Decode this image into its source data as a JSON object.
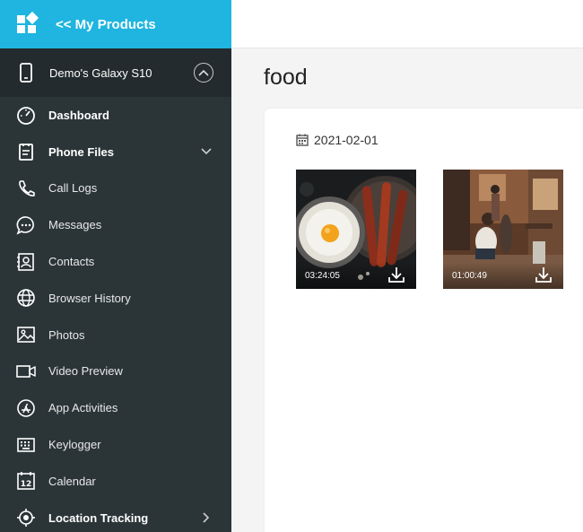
{
  "brand": {
    "title": "<< My Products",
    "icon": "app-grid-icon",
    "bg": "#1fb5e0"
  },
  "device": {
    "name": "Demo's Galaxy S10",
    "icon": "phone-icon",
    "toggle_icon": "chevron-up-circle-icon"
  },
  "nav": [
    {
      "label": "Dashboard",
      "icon": "speedometer-icon",
      "bold": true
    },
    {
      "label": "Phone Files",
      "icon": "clipboard-icon",
      "bold": true,
      "chevron": "down"
    },
    {
      "label": "Call Logs",
      "icon": "phone-handset-icon"
    },
    {
      "label": "Messages",
      "icon": "chat-bubble-icon"
    },
    {
      "label": "Contacts",
      "icon": "contact-card-icon"
    },
    {
      "label": "Browser History",
      "icon": "globe-icon"
    },
    {
      "label": "Photos",
      "icon": "image-icon"
    },
    {
      "label": "Video Preview",
      "icon": "video-camera-icon"
    },
    {
      "label": "App Activities",
      "icon": "app-store-icon"
    },
    {
      "label": "Keylogger",
      "icon": "keyboard-icon"
    },
    {
      "label": "Calendar",
      "icon": "calendar-12-icon"
    },
    {
      "label": "Location Tracking",
      "icon": "location-target-icon",
      "bold": true,
      "chevron": "right"
    }
  ],
  "main": {
    "title": "food",
    "date": "2021-02-01",
    "videos": [
      {
        "duration": "03:24:05",
        "scene": "egg-and-bacon"
      },
      {
        "duration": "01:00:49",
        "scene": "people-in-room"
      }
    ]
  },
  "colors": {
    "sidebar": "#2b3538",
    "accent": "#1fb5e0"
  }
}
